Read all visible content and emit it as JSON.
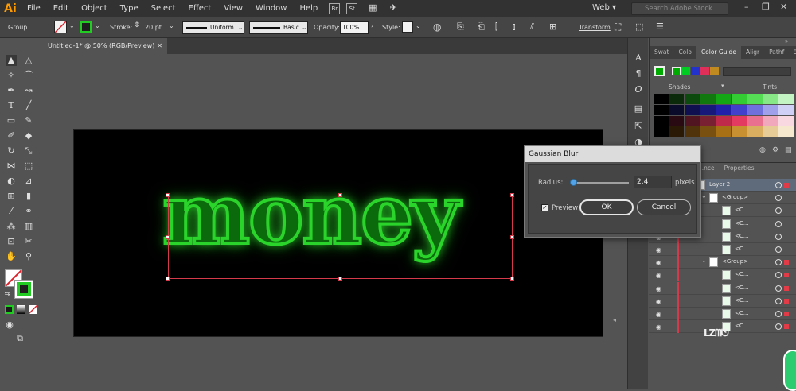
{
  "app": {
    "logo": "Ai"
  },
  "menu": [
    "File",
    "Edit",
    "Object",
    "Type",
    "Select",
    "Effect",
    "View",
    "Window",
    "Help"
  ],
  "bridge_icons": [
    "Br",
    "St"
  ],
  "workspace": "Web",
  "search": {
    "placeholder": "Search Adobe Stock"
  },
  "control_bar": {
    "selection": "Group",
    "stroke_label": "Stroke:",
    "stroke_value": "20 pt",
    "profile": "Uniform",
    "brush": "Basic",
    "opacity_label": "Opacity:",
    "opacity_value": "100%",
    "style_label": "Style:",
    "transform_label": "Transform"
  },
  "document": {
    "tab_title": "Untitled-1* @ 50% (RGB/Preview)",
    "artwork_text": "money"
  },
  "color_guide": {
    "tabs": [
      "Swat",
      "Colo",
      "Color Guide",
      "Aligr",
      "Pathf"
    ],
    "shades_label": "Shades",
    "tints_label": "Tints",
    "harmony_colors": [
      "#00aa00",
      "#00cc22",
      "#2233cc",
      "#e0305a",
      "#c08a20"
    ],
    "grid_colors": [
      [
        "#000000",
        "#0a2a0a",
        "#0d4a0d",
        "#10780f",
        "#15a615",
        "#33cc33",
        "#55dd55",
        "#88e888",
        "#c4f4c4"
      ],
      [
        "#000000",
        "#0a0a2a",
        "#101050",
        "#18187a",
        "#2020aa",
        "#4040cc",
        "#7070dd",
        "#a0a0ea",
        "#d0d0f6"
      ],
      [
        "#000000",
        "#2a0a12",
        "#501520",
        "#7a2033",
        "#c02a4a",
        "#e23a60",
        "#ea7090",
        "#f2a8bc",
        "#fad8e2"
      ],
      [
        "#000000",
        "#2a1a05",
        "#50330a",
        "#7a5010",
        "#a87015",
        "#c89030",
        "#daae60",
        "#e8cc98",
        "#f6e8ce"
      ]
    ]
  },
  "layers_panel": {
    "tabs": [
      "...nce",
      "Properties"
    ],
    "rows": [
      {
        "name": "Layer 2",
        "indent": 0,
        "selected": true
      },
      {
        "name": "<Group>",
        "indent": 1
      },
      {
        "name": "<C...",
        "indent": 2
      },
      {
        "name": "<C...",
        "indent": 2
      },
      {
        "name": "<C...",
        "indent": 2
      },
      {
        "name": "<C...",
        "indent": 2
      },
      {
        "name": "<Group>",
        "indent": 1
      },
      {
        "name": "<C...",
        "indent": 2
      },
      {
        "name": "<C...",
        "indent": 2
      },
      {
        "name": "<C...",
        "indent": 2
      },
      {
        "name": "<C...",
        "indent": 2
      },
      {
        "name": "<C...",
        "indent": 2
      }
    ]
  },
  "dialog": {
    "title": "Gaussian Blur",
    "radius_label": "Radius:",
    "radius_value": "2.4",
    "radius_unit": "pixels",
    "preview_label": "Preview",
    "preview_checked": true,
    "ok_label": "OK",
    "cancel_label": "Cancel"
  }
}
